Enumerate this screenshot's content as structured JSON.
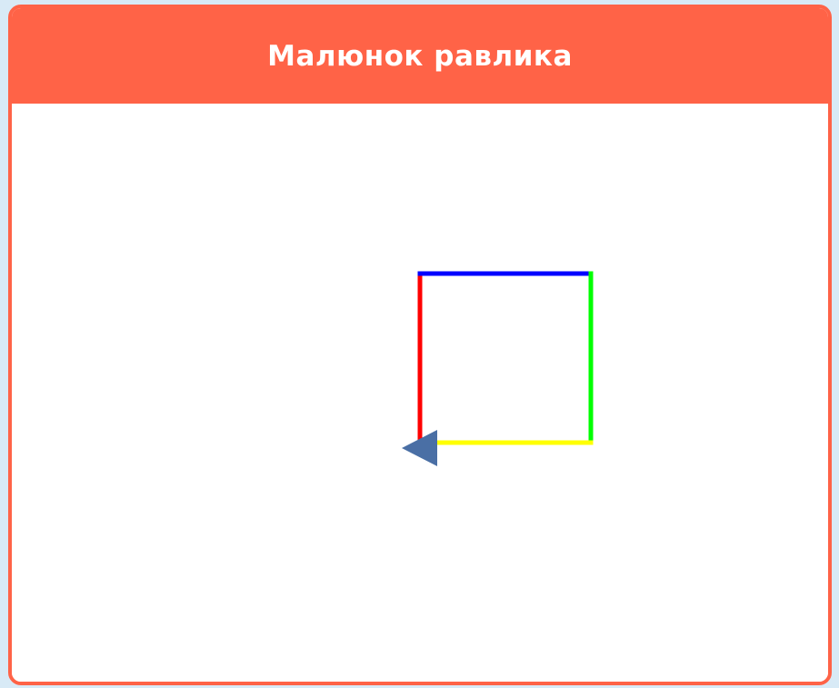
{
  "panel": {
    "title": "Малюнок равлика"
  },
  "drawing": {
    "segments": [
      {
        "name": "left-side",
        "color": "#ff0000"
      },
      {
        "name": "top-side",
        "color": "#0000ff"
      },
      {
        "name": "right-side",
        "color": "#00ff00"
      },
      {
        "name": "bottom-side",
        "color": "#ffff00"
      }
    ],
    "turtle": {
      "color": "#4a6fa5",
      "icon": "turtle-arrow-icon",
      "heading": "left"
    }
  }
}
